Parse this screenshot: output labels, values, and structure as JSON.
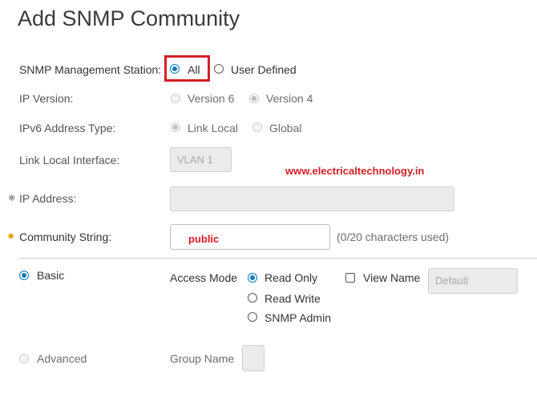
{
  "title": "Add SNMP Community",
  "watermark": "www.electricaltechnology.in",
  "management_station": {
    "label": "SNMP Management Station:",
    "options": [
      {
        "label": "All",
        "selected": true
      },
      {
        "label": "User Defined",
        "selected": false
      }
    ]
  },
  "ip_version": {
    "label": "IP Version:",
    "options": [
      {
        "label": "Version 6",
        "selected": false
      },
      {
        "label": "Version 4",
        "selected": true
      }
    ]
  },
  "ipv6_address_type": {
    "label": "IPv6 Address Type:",
    "options": [
      {
        "label": "Link Local",
        "selected": true
      },
      {
        "label": "Global",
        "selected": false
      }
    ]
  },
  "link_local_interface": {
    "label": "Link Local Interface:",
    "value": "VLAN 1"
  },
  "ip_address": {
    "label": "IP Address:",
    "value": ""
  },
  "community_string": {
    "label": "Community String:",
    "value": "public",
    "usage": "(0/20 characters used)"
  },
  "basic": {
    "label": "Basic",
    "selected": true,
    "access_mode": {
      "label": "Access Mode",
      "options": [
        {
          "label": "Read Only",
          "selected": true
        },
        {
          "label": "Read Write",
          "selected": false
        },
        {
          "label": "SNMP Admin",
          "selected": false
        }
      ]
    },
    "view_name": {
      "label": "View Name",
      "checked": false,
      "placeholder": "Default"
    }
  },
  "advanced": {
    "label": "Advanced",
    "selected": false,
    "group_name": {
      "label": "Group Name",
      "value": ""
    }
  },
  "colors": {
    "accent": "#0d7ab8",
    "highlight": "#d51e26",
    "required": "#e8a317"
  }
}
